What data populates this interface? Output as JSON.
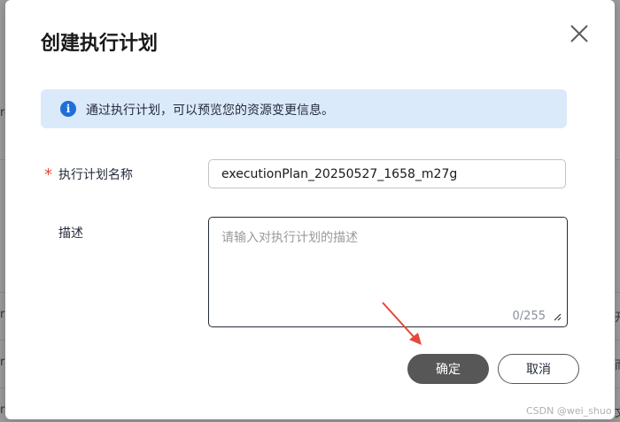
{
  "modal": {
    "title": "创建执行计划",
    "close_icon": "close-icon"
  },
  "info": {
    "icon": "info-icon",
    "icon_glyph": "i",
    "text": "通过执行计划，可以预览您的资源变更信息。",
    "background": "#dbeafb",
    "icon_color": "#1f6fd8"
  },
  "form": {
    "name": {
      "required_mark": "*",
      "label": "执行计划名称",
      "value": "executionPlan_20250527_1658_m27g"
    },
    "description": {
      "label": "描述",
      "placeholder": "请输入对执行计划的描述",
      "counter": "0/255"
    }
  },
  "buttons": {
    "ok_label": "确定",
    "cancel_label": "取消",
    "ok_color": "#575757"
  },
  "annotation": {
    "arrow_color": "#e5483c"
  },
  "watermark": "CSDN @wei_shuo",
  "background": {
    "edge_letters": [
      "re",
      "r",
      "r",
      "r",
      "开",
      "而",
      "文"
    ]
  }
}
